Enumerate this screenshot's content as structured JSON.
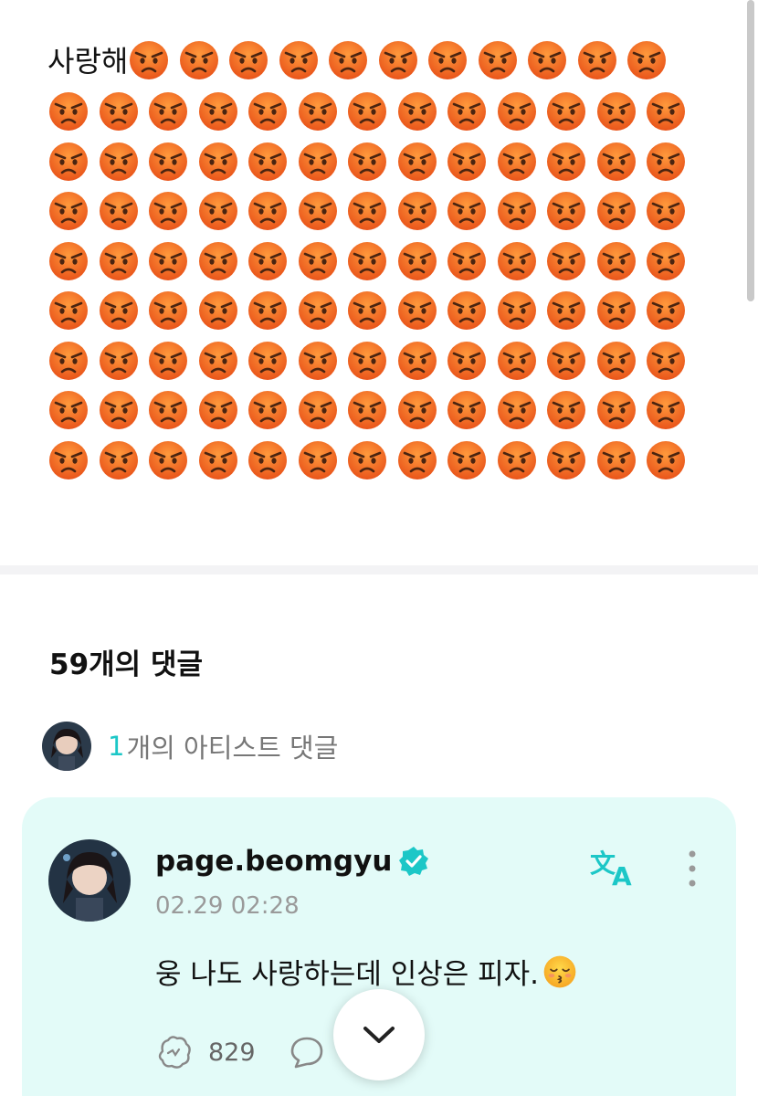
{
  "post": {
    "text": "사랑해",
    "emoji_name": "pouting-face-emoji",
    "emoji_count": 115
  },
  "comments_header": {
    "title": "59개의 댓글"
  },
  "artist_comments": {
    "count": "1",
    "label": "개의 아티스트 댓글"
  },
  "comment": {
    "username": "page.beomgyu",
    "timestamp": "02.29 02:28",
    "text": "웅 나도 사랑하는데 인상은 피자.",
    "emoji_name": "kissing-face-emoji",
    "like_count": "829",
    "icons": [
      "verified-icon",
      "translate-icon",
      "more-icon",
      "like-icon",
      "reply-icon"
    ]
  },
  "colors": {
    "accent": "#1cc7c7",
    "card_background": "#e3fbf8",
    "emoji_orange": "#f47a1f"
  },
  "scroll_button": {
    "icon": "chevron-down-icon"
  }
}
